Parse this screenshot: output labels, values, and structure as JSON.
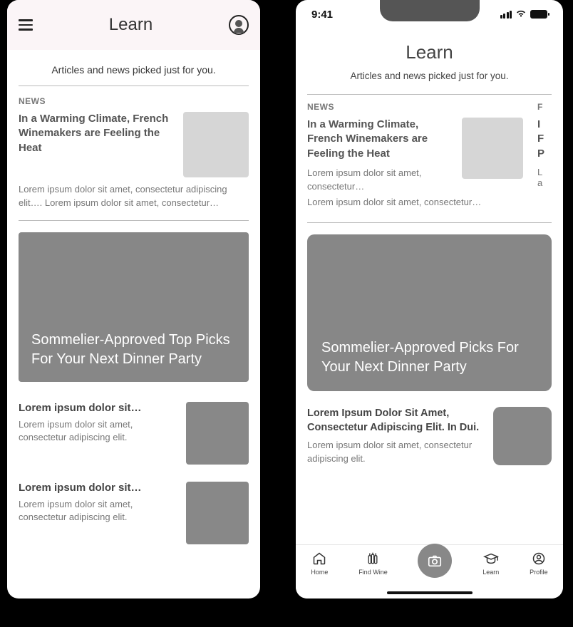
{
  "left": {
    "header": {
      "title": "Learn"
    },
    "subtitle": "Articles and news picked just for you.",
    "news": {
      "label": "NEWS",
      "title": "In a Warming Climate, French Winemakers are Feeling the Heat",
      "desc": "Lorem ipsum dolor sit amet, consectetur adipiscing elit…. Lorem ipsum dolor sit amet, consectetur…"
    },
    "hero": {
      "title": "Sommelier-Approved Top Picks For Your Next Dinner Party"
    },
    "list": [
      {
        "title": "Lorem ipsum dolor sit…",
        "desc": "Lorem ipsum dolor sit amet, consectetur adipiscing elit."
      },
      {
        "title": "Lorem ipsum dolor sit…",
        "desc": "Lorem ipsum dolor sit amet, consectetur adipiscing elit."
      }
    ]
  },
  "right": {
    "status": {
      "time": "9:41"
    },
    "header": {
      "title": "Learn"
    },
    "subtitle": "Articles and news picked just for you.",
    "news": {
      "label": "NEWS",
      "title": "In a Warming Climate, French Winemakers are Feeling the Heat",
      "desc1": "Lorem ipsum dolor sit amet, consectetur…",
      "desc2": "Lorem ipsum dolor sit amet, consectetur…"
    },
    "peek": {
      "label": "F",
      "title": "I\nF\nP",
      "desc": "L\na"
    },
    "hero": {
      "title": "Sommelier-Approved Picks For Your Next Dinner Party"
    },
    "list": [
      {
        "title": "Lorem Ipsum Dolor Sit Amet, Consectetur Adipiscing Elit. In Dui.",
        "desc": "Lorem ipsum dolor sit amet, consectetur adipiscing elit."
      }
    ],
    "tabs": {
      "home": "Home",
      "find": "Find Wine",
      "learn": "Learn",
      "profile": "Profile"
    }
  }
}
